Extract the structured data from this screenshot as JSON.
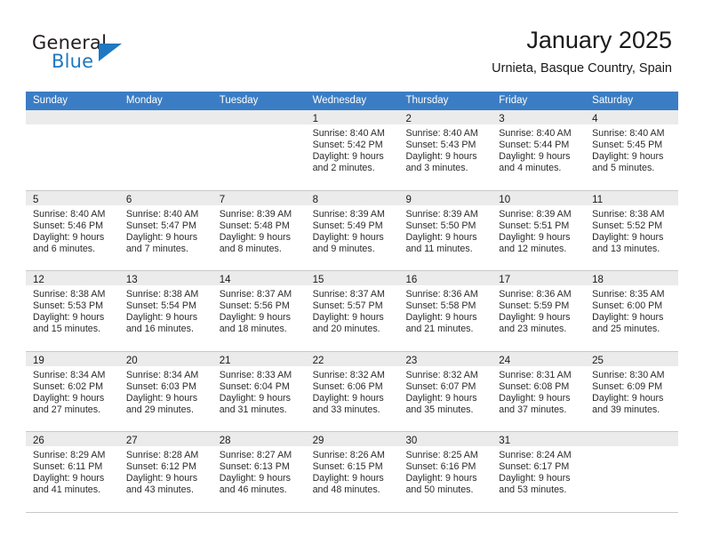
{
  "brand": {
    "word_general": "General",
    "word_blue": "Blue",
    "accent_color": "#1f78c1"
  },
  "header": {
    "title": "January 2025",
    "subtitle": "Urnieta, Basque Country, Spain"
  },
  "calendar": {
    "header_bg": "#3b7dc4",
    "day_band_bg": "#ebebeb",
    "weekdays": [
      "Sunday",
      "Monday",
      "Tuesday",
      "Wednesday",
      "Thursday",
      "Friday",
      "Saturday"
    ],
    "weeks": [
      [
        {
          "day": "",
          "lines": []
        },
        {
          "day": "",
          "lines": []
        },
        {
          "day": "",
          "lines": []
        },
        {
          "day": "1",
          "lines": [
            "Sunrise: 8:40 AM",
            "Sunset: 5:42 PM",
            "Daylight: 9 hours",
            "and 2 minutes."
          ]
        },
        {
          "day": "2",
          "lines": [
            "Sunrise: 8:40 AM",
            "Sunset: 5:43 PM",
            "Daylight: 9 hours",
            "and 3 minutes."
          ]
        },
        {
          "day": "3",
          "lines": [
            "Sunrise: 8:40 AM",
            "Sunset: 5:44 PM",
            "Daylight: 9 hours",
            "and 4 minutes."
          ]
        },
        {
          "day": "4",
          "lines": [
            "Sunrise: 8:40 AM",
            "Sunset: 5:45 PM",
            "Daylight: 9 hours",
            "and 5 minutes."
          ]
        }
      ],
      [
        {
          "day": "5",
          "lines": [
            "Sunrise: 8:40 AM",
            "Sunset: 5:46 PM",
            "Daylight: 9 hours",
            "and 6 minutes."
          ]
        },
        {
          "day": "6",
          "lines": [
            "Sunrise: 8:40 AM",
            "Sunset: 5:47 PM",
            "Daylight: 9 hours",
            "and 7 minutes."
          ]
        },
        {
          "day": "7",
          "lines": [
            "Sunrise: 8:39 AM",
            "Sunset: 5:48 PM",
            "Daylight: 9 hours",
            "and 8 minutes."
          ]
        },
        {
          "day": "8",
          "lines": [
            "Sunrise: 8:39 AM",
            "Sunset: 5:49 PM",
            "Daylight: 9 hours",
            "and 9 minutes."
          ]
        },
        {
          "day": "9",
          "lines": [
            "Sunrise: 8:39 AM",
            "Sunset: 5:50 PM",
            "Daylight: 9 hours",
            "and 11 minutes."
          ]
        },
        {
          "day": "10",
          "lines": [
            "Sunrise: 8:39 AM",
            "Sunset: 5:51 PM",
            "Daylight: 9 hours",
            "and 12 minutes."
          ]
        },
        {
          "day": "11",
          "lines": [
            "Sunrise: 8:38 AM",
            "Sunset: 5:52 PM",
            "Daylight: 9 hours",
            "and 13 minutes."
          ]
        }
      ],
      [
        {
          "day": "12",
          "lines": [
            "Sunrise: 8:38 AM",
            "Sunset: 5:53 PM",
            "Daylight: 9 hours",
            "and 15 minutes."
          ]
        },
        {
          "day": "13",
          "lines": [
            "Sunrise: 8:38 AM",
            "Sunset: 5:54 PM",
            "Daylight: 9 hours",
            "and 16 minutes."
          ]
        },
        {
          "day": "14",
          "lines": [
            "Sunrise: 8:37 AM",
            "Sunset: 5:56 PM",
            "Daylight: 9 hours",
            "and 18 minutes."
          ]
        },
        {
          "day": "15",
          "lines": [
            "Sunrise: 8:37 AM",
            "Sunset: 5:57 PM",
            "Daylight: 9 hours",
            "and 20 minutes."
          ]
        },
        {
          "day": "16",
          "lines": [
            "Sunrise: 8:36 AM",
            "Sunset: 5:58 PM",
            "Daylight: 9 hours",
            "and 21 minutes."
          ]
        },
        {
          "day": "17",
          "lines": [
            "Sunrise: 8:36 AM",
            "Sunset: 5:59 PM",
            "Daylight: 9 hours",
            "and 23 minutes."
          ]
        },
        {
          "day": "18",
          "lines": [
            "Sunrise: 8:35 AM",
            "Sunset: 6:00 PM",
            "Daylight: 9 hours",
            "and 25 minutes."
          ]
        }
      ],
      [
        {
          "day": "19",
          "lines": [
            "Sunrise: 8:34 AM",
            "Sunset: 6:02 PM",
            "Daylight: 9 hours",
            "and 27 minutes."
          ]
        },
        {
          "day": "20",
          "lines": [
            "Sunrise: 8:34 AM",
            "Sunset: 6:03 PM",
            "Daylight: 9 hours",
            "and 29 minutes."
          ]
        },
        {
          "day": "21",
          "lines": [
            "Sunrise: 8:33 AM",
            "Sunset: 6:04 PM",
            "Daylight: 9 hours",
            "and 31 minutes."
          ]
        },
        {
          "day": "22",
          "lines": [
            "Sunrise: 8:32 AM",
            "Sunset: 6:06 PM",
            "Daylight: 9 hours",
            "and 33 minutes."
          ]
        },
        {
          "day": "23",
          "lines": [
            "Sunrise: 8:32 AM",
            "Sunset: 6:07 PM",
            "Daylight: 9 hours",
            "and 35 minutes."
          ]
        },
        {
          "day": "24",
          "lines": [
            "Sunrise: 8:31 AM",
            "Sunset: 6:08 PM",
            "Daylight: 9 hours",
            "and 37 minutes."
          ]
        },
        {
          "day": "25",
          "lines": [
            "Sunrise: 8:30 AM",
            "Sunset: 6:09 PM",
            "Daylight: 9 hours",
            "and 39 minutes."
          ]
        }
      ],
      [
        {
          "day": "26",
          "lines": [
            "Sunrise: 8:29 AM",
            "Sunset: 6:11 PM",
            "Daylight: 9 hours",
            "and 41 minutes."
          ]
        },
        {
          "day": "27",
          "lines": [
            "Sunrise: 8:28 AM",
            "Sunset: 6:12 PM",
            "Daylight: 9 hours",
            "and 43 minutes."
          ]
        },
        {
          "day": "28",
          "lines": [
            "Sunrise: 8:27 AM",
            "Sunset: 6:13 PM",
            "Daylight: 9 hours",
            "and 46 minutes."
          ]
        },
        {
          "day": "29",
          "lines": [
            "Sunrise: 8:26 AM",
            "Sunset: 6:15 PM",
            "Daylight: 9 hours",
            "and 48 minutes."
          ]
        },
        {
          "day": "30",
          "lines": [
            "Sunrise: 8:25 AM",
            "Sunset: 6:16 PM",
            "Daylight: 9 hours",
            "and 50 minutes."
          ]
        },
        {
          "day": "31",
          "lines": [
            "Sunrise: 8:24 AM",
            "Sunset: 6:17 PM",
            "Daylight: 9 hours",
            "and 53 minutes."
          ]
        },
        {
          "day": "",
          "lines": []
        }
      ]
    ]
  }
}
